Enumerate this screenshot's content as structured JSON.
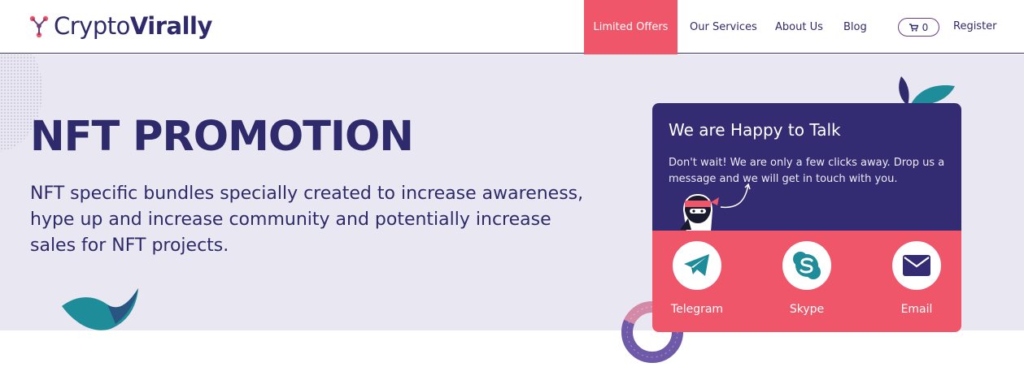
{
  "brand": {
    "name_light": "Crypto",
    "name_bold": "Virally"
  },
  "nav": {
    "limited_offers": "Limited Offers",
    "services": "Our Services",
    "about": "About Us",
    "blog": "Blog",
    "cart_count": "0",
    "register": "Register"
  },
  "hero": {
    "title": "NFT PROMOTION",
    "description": "NFT specific bundles specially created to increase awareness, hype up and increase community and potentially increase sales for NFT projects."
  },
  "chat": {
    "title": "We are Happy to Talk",
    "text": "Don't wait! We are only a few clicks away. Drop us a message and we will get in touch with you.",
    "channels": [
      {
        "label": "Telegram",
        "icon": "telegram-icon"
      },
      {
        "label": "Skype",
        "icon": "skype-icon"
      },
      {
        "label": "Email",
        "icon": "email-icon"
      }
    ]
  },
  "colors": {
    "navy": "#2f2a6b",
    "card_navy": "#332c73",
    "coral": "#f0566a",
    "hero_bg": "#e9e7f2",
    "teal": "#1f8c9a"
  }
}
